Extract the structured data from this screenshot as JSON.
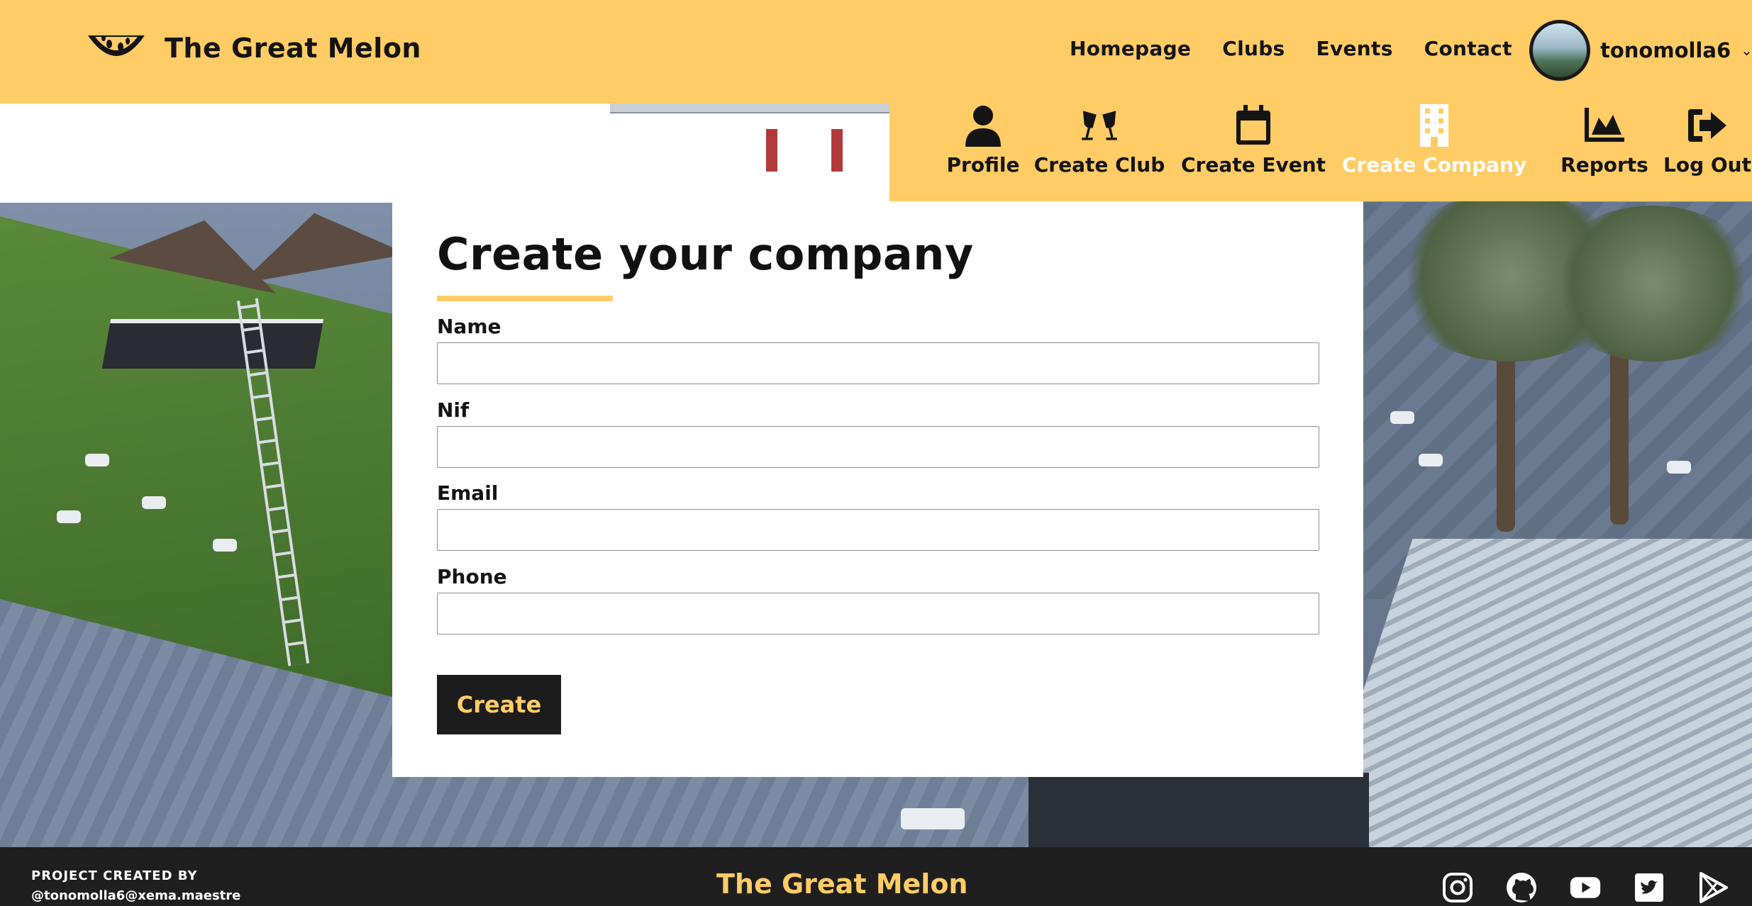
{
  "header": {
    "brand": "The Great Melon",
    "nav": [
      "Homepage",
      "Clubs",
      "Events",
      "Contact"
    ],
    "username": "tonomolla6"
  },
  "menu": {
    "items": [
      {
        "label": "Profile",
        "icon": "user-icon"
      },
      {
        "label": "Create Club",
        "icon": "cheers-icon"
      },
      {
        "label": "Create Event",
        "icon": "calendar-icon"
      },
      {
        "label": "Create Company",
        "icon": "building-icon",
        "active": true
      },
      {
        "label": "Reports",
        "icon": "chart-area-icon"
      },
      {
        "label": "Log Out",
        "icon": "sign-out-icon"
      }
    ]
  },
  "form": {
    "title": "Create your company",
    "fields": [
      {
        "label": "Name",
        "value": ""
      },
      {
        "label": "Nif",
        "value": ""
      },
      {
        "label": "Email",
        "value": ""
      },
      {
        "label": "Phone",
        "value": ""
      }
    ],
    "submit_label": "Create"
  },
  "footer": {
    "credit_line1": "PROJECT CREATED BY",
    "credit_line2": "@tonomolla6@xema.maestre",
    "brand": "The Great Melon",
    "socials": [
      "instagram-icon",
      "github-icon",
      "youtube-icon",
      "twitter-icon",
      "google-play-icon"
    ]
  },
  "colors": {
    "accent": "#ffcc66",
    "dark": "#1f1f1f",
    "active_menu_text": "#ffffff"
  }
}
